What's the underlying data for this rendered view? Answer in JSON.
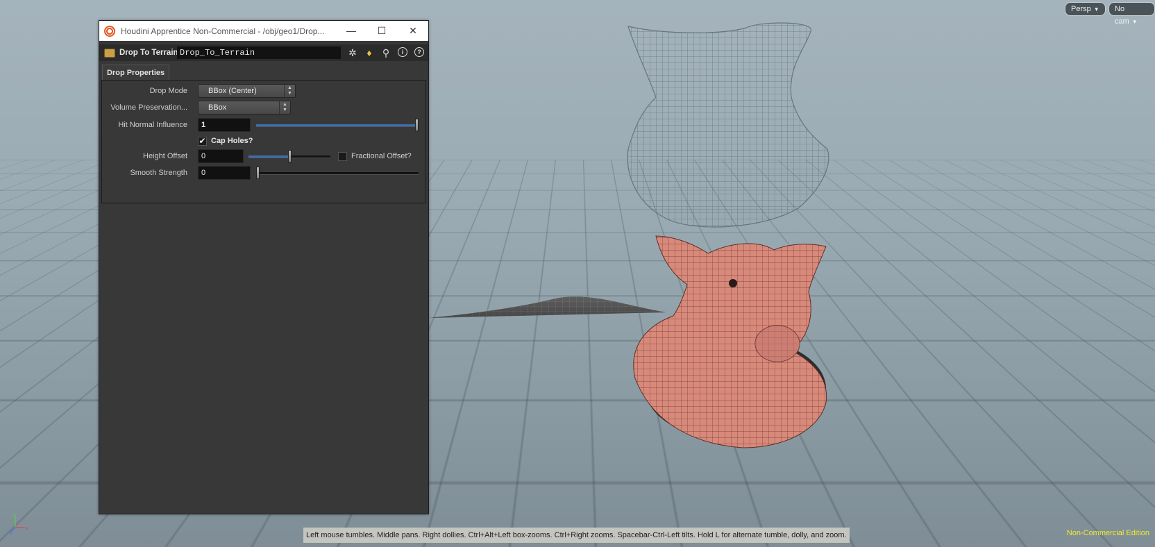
{
  "viewport": {
    "persp_button": "Persp",
    "cam_button": "No cam",
    "status_message": "Left mouse tumbles. Middle pans. Right dollies. Ctrl+Alt+Left box-zooms. Ctrl+Right zooms. Spacebar-Ctrl-Left tilts. Hold L for alternate tumble, dolly, and zoom.",
    "edition_label": "Non-Commercial Edition",
    "axis_labels": {
      "x": "x",
      "y": "y",
      "z": "z"
    },
    "colors": {
      "edition_text": "#f2ea2a",
      "pig_skin": "#d88a7c",
      "terrain": "#5c5c5c"
    }
  },
  "window": {
    "title": "Houdini Apprentice Non-Commercial - /obj/geo1/Drop...",
    "controls": {
      "minimize": "—",
      "maximize": "☐",
      "close": "✕"
    }
  },
  "toolbar": {
    "node_type_label": "Drop To Terrain",
    "node_name": "Drop_To_Terrain",
    "icons": [
      "gear-icon",
      "python-icon",
      "search-icon",
      "info-icon",
      "help-icon"
    ],
    "info_glyph": "i",
    "help_glyph": "?"
  },
  "tabs": [
    {
      "label": "Drop Properties"
    }
  ],
  "params": {
    "drop_mode": {
      "label": "Drop Mode",
      "value": "BBox (Center)"
    },
    "volume_preservation": {
      "label": "Volume Preservation...",
      "value": "BBox"
    },
    "hit_normal_influence": {
      "label": "Hit Normal Influence",
      "value": "1",
      "slider_fraction": 1.0
    },
    "cap_holes": {
      "label": "Cap Holes?",
      "checked": true,
      "check_glyph": "✔"
    },
    "height_offset": {
      "label": "Height Offset",
      "value": "0",
      "slider_fraction": 0.5
    },
    "fractional_offset": {
      "label": "Fractional Offset?",
      "checked": false
    },
    "smooth_strength": {
      "label": "Smooth Strength",
      "value": "0",
      "slider_fraction": 0.0
    }
  }
}
